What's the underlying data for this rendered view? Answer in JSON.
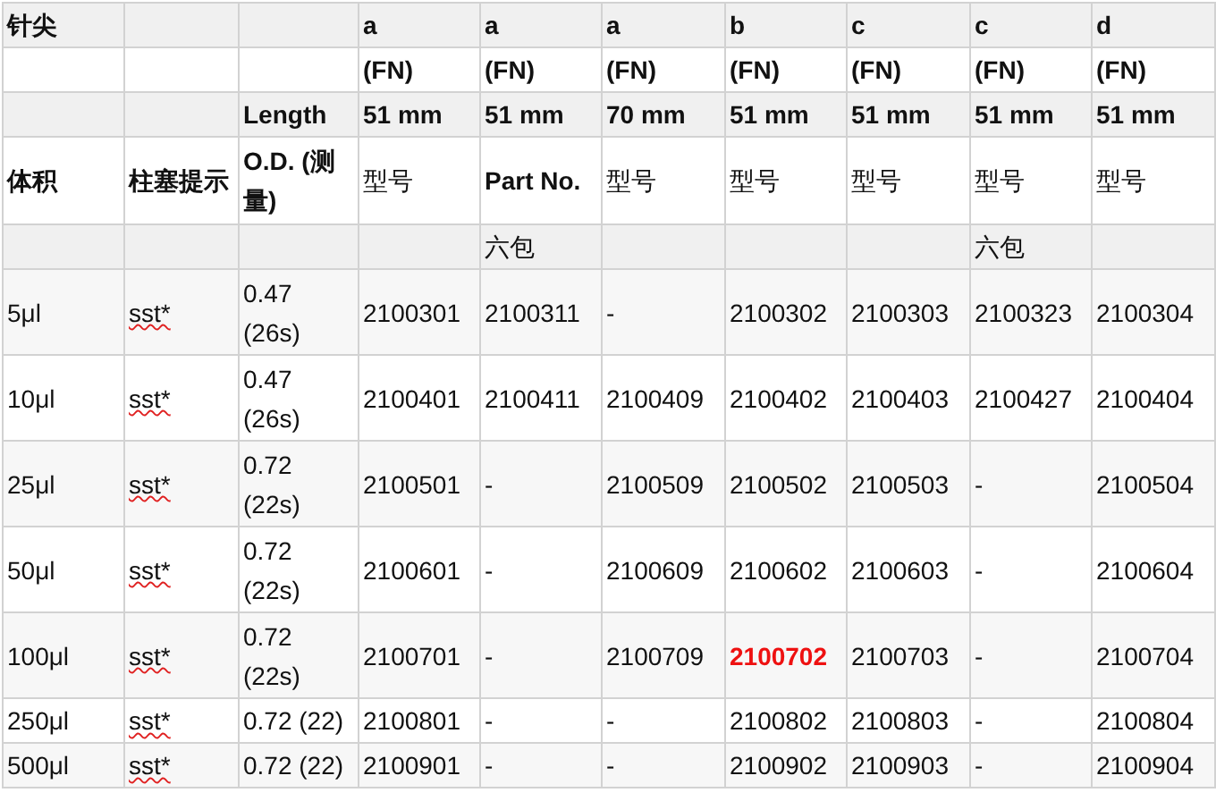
{
  "table": {
    "header_rows": [
      [
        {
          "text": "针尖",
          "bold": true
        },
        null,
        null,
        {
          "text": "a",
          "bold": true
        },
        {
          "text": "a",
          "bold": true
        },
        {
          "text": "a",
          "bold": true
        },
        {
          "text": "b",
          "bold": true
        },
        {
          "text": "c",
          "bold": true
        },
        {
          "text": "c",
          "bold": true
        },
        {
          "text": "d",
          "bold": true
        }
      ],
      [
        null,
        null,
        null,
        {
          "text": "(FN)",
          "bold": true
        },
        {
          "text": "(FN)",
          "bold": true
        },
        {
          "text": "(FN)",
          "bold": true
        },
        {
          "text": "(FN)",
          "bold": true
        },
        {
          "text": "(FN)",
          "bold": true
        },
        {
          "text": "(FN)",
          "bold": true
        },
        {
          "text": "(FN)",
          "bold": true
        }
      ],
      [
        null,
        null,
        {
          "text": "Length",
          "bold": true
        },
        {
          "text": "51 mm",
          "bold": true
        },
        {
          "text": "51 mm",
          "bold": true
        },
        {
          "text": "70 mm",
          "bold": true
        },
        {
          "text": "51 mm",
          "bold": true
        },
        {
          "text": "51 mm",
          "bold": true
        },
        {
          "text": "51 mm",
          "bold": true
        },
        {
          "text": "51 mm",
          "bold": true
        }
      ],
      [
        {
          "text": "体积",
          "bold": true
        },
        {
          "text": "柱塞提示",
          "bold": true
        },
        {
          "text": "O.D. (测量)",
          "bold": true
        },
        {
          "text": "型号",
          "bold": false
        },
        {
          "text": "Part No.",
          "bold": true
        },
        {
          "text": "型号",
          "bold": false
        },
        {
          "text": "型号",
          "bold": false
        },
        {
          "text": "型号",
          "bold": false
        },
        {
          "text": "型号",
          "bold": false
        },
        {
          "text": "型号",
          "bold": false
        }
      ],
      [
        null,
        null,
        null,
        null,
        {
          "text": "六包",
          "bold": false
        },
        null,
        null,
        null,
        {
          "text": "六包",
          "bold": false
        },
        null
      ]
    ],
    "rows": [
      [
        "5μl",
        {
          "text": "sst*",
          "misspelled": true
        },
        "0.47 (26s)",
        "2100301",
        "2100311",
        "-",
        "2100302",
        "2100303",
        "2100323",
        "2100304"
      ],
      [
        "10μl",
        {
          "text": "sst*",
          "misspelled": true
        },
        "0.47 (26s)",
        "2100401",
        "2100411",
        "2100409",
        "2100402",
        "2100403",
        "2100427",
        "2100404"
      ],
      [
        "25μl",
        {
          "text": "sst*",
          "misspelled": true
        },
        "0.72 (22s)",
        "2100501",
        "-",
        "2100509",
        "2100502",
        "2100503",
        "-",
        "2100504"
      ],
      [
        "50μl",
        {
          "text": "sst*",
          "misspelled": true
        },
        "0.72 (22s)",
        "2100601",
        "-",
        "2100609",
        "2100602",
        "2100603",
        "-",
        "2100604"
      ],
      [
        "100μl",
        {
          "text": "sst*",
          "misspelled": true
        },
        "0.72 (22s)",
        "2100701",
        "-",
        "2100709",
        {
          "text": "2100702",
          "emphasis": true
        },
        "2100703",
        "-",
        "2100704"
      ],
      [
        "250μl",
        {
          "text": "sst*",
          "misspelled": true
        },
        "0.72 (22)",
        "2100801",
        "-",
        "-",
        "2100802",
        "2100803",
        "-",
        "2100804"
      ],
      [
        "500μl",
        {
          "text": "sst*",
          "misspelled": true
        },
        "0.72 (22)",
        "2100901",
        "-",
        "-",
        "2100902",
        "2100903",
        "-",
        "2100904"
      ]
    ]
  }
}
